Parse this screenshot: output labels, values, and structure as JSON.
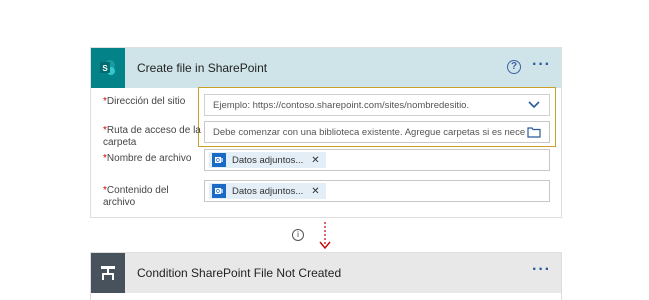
{
  "create_card": {
    "title": "Create file in SharePoint",
    "fields": [
      {
        "label": "Dirección del sitio",
        "placeholder": "Ejemplo: https://contoso.sharepoint.com/sites/nombredesitio."
      },
      {
        "label": "Ruta de acceso de la carpeta",
        "placeholder": "Debe comenzar con una biblioteca existente. Agregue carpetas si es nece"
      },
      {
        "label": "Nombre de archivo",
        "token": "Datos adjuntos..."
      },
      {
        "label": "Contenido del archivo",
        "token": "Datos adjuntos..."
      }
    ],
    "required_mark": "*",
    "help_glyph": "?",
    "more_glyph": "···"
  },
  "connector": {
    "info_glyph": "i"
  },
  "condition_card": {
    "title": "Condition SharePoint File Not Created",
    "more_glyph": "···"
  },
  "colors": {
    "sharepoint": "#038387",
    "condition": "#48525d",
    "accent_blue": "#2c5b9d",
    "highlight": "#c8a02a",
    "arrow": "#c80000"
  },
  "icons": [
    "sharepoint-icon",
    "help-icon",
    "more-icon",
    "chevron-down-icon",
    "folder-icon",
    "outlook-icon",
    "remove-icon",
    "info-icon",
    "arrow-down-icon",
    "condition-icon"
  ]
}
